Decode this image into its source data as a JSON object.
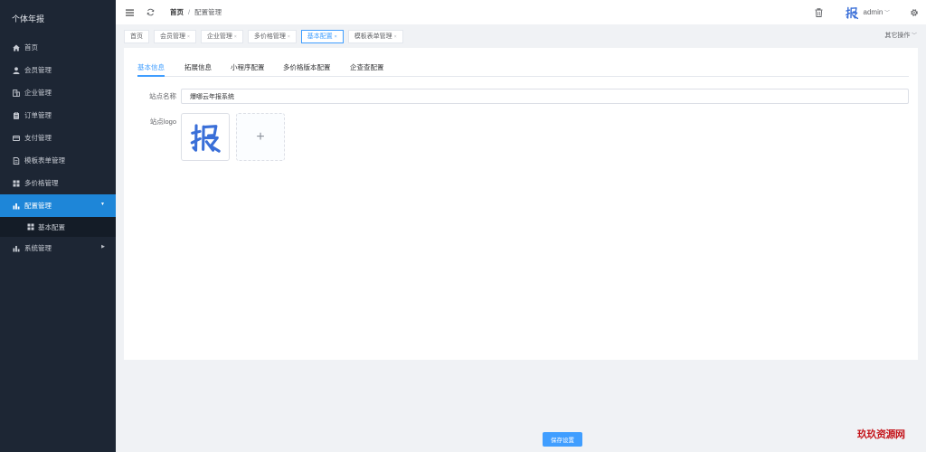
{
  "app": {
    "title": "个体年报"
  },
  "sidebar": {
    "items": [
      {
        "label": "首页",
        "icon": "home-icon"
      },
      {
        "label": "会员管理",
        "icon": "user-icon"
      },
      {
        "label": "企业管理",
        "icon": "building-icon"
      },
      {
        "label": "订单管理",
        "icon": "clipboard-icon"
      },
      {
        "label": "支付管理",
        "icon": "card-icon"
      },
      {
        "label": "模板表单管理",
        "icon": "document-icon"
      },
      {
        "label": "多价格管理",
        "icon": "grid-icon"
      },
      {
        "label": "配置管理",
        "icon": "bar-chart-icon",
        "expanded": true
      },
      {
        "label": "基本配置",
        "icon": "grid-icon"
      },
      {
        "label": "系统管理",
        "icon": "bar-chart-icon"
      }
    ]
  },
  "header": {
    "breadcrumb": {
      "home": "首页",
      "separator": "/",
      "current": "配置管理"
    },
    "user": {
      "name": "admin"
    }
  },
  "tags": {
    "items": [
      {
        "label": "首页"
      },
      {
        "label": "会员管理"
      },
      {
        "label": "企业管理"
      },
      {
        "label": "多价格管理"
      },
      {
        "label": "基本配置",
        "active": true
      },
      {
        "label": "模板表单管理"
      }
    ],
    "more": "其它操作"
  },
  "settings": {
    "tabs": [
      "基本信息",
      "拓展信息",
      "小程序配置",
      "多价格版本配置",
      "企查查配置"
    ],
    "active_tab": "基本信息",
    "site_name_label": "站点名称",
    "site_name_value": "爆哪云年报系统",
    "site_logo_label": "站点logo",
    "logo_glyph": "报",
    "upload_glyph": "+",
    "save_label": "保存设置"
  },
  "watermark": {
    "text": "玖玖资源网"
  },
  "colors": {
    "sidebar_bg": "#1d2634",
    "accent": "#409eff",
    "active_menu": "#1e86d8",
    "logo_blue": "#3a6fd8"
  }
}
